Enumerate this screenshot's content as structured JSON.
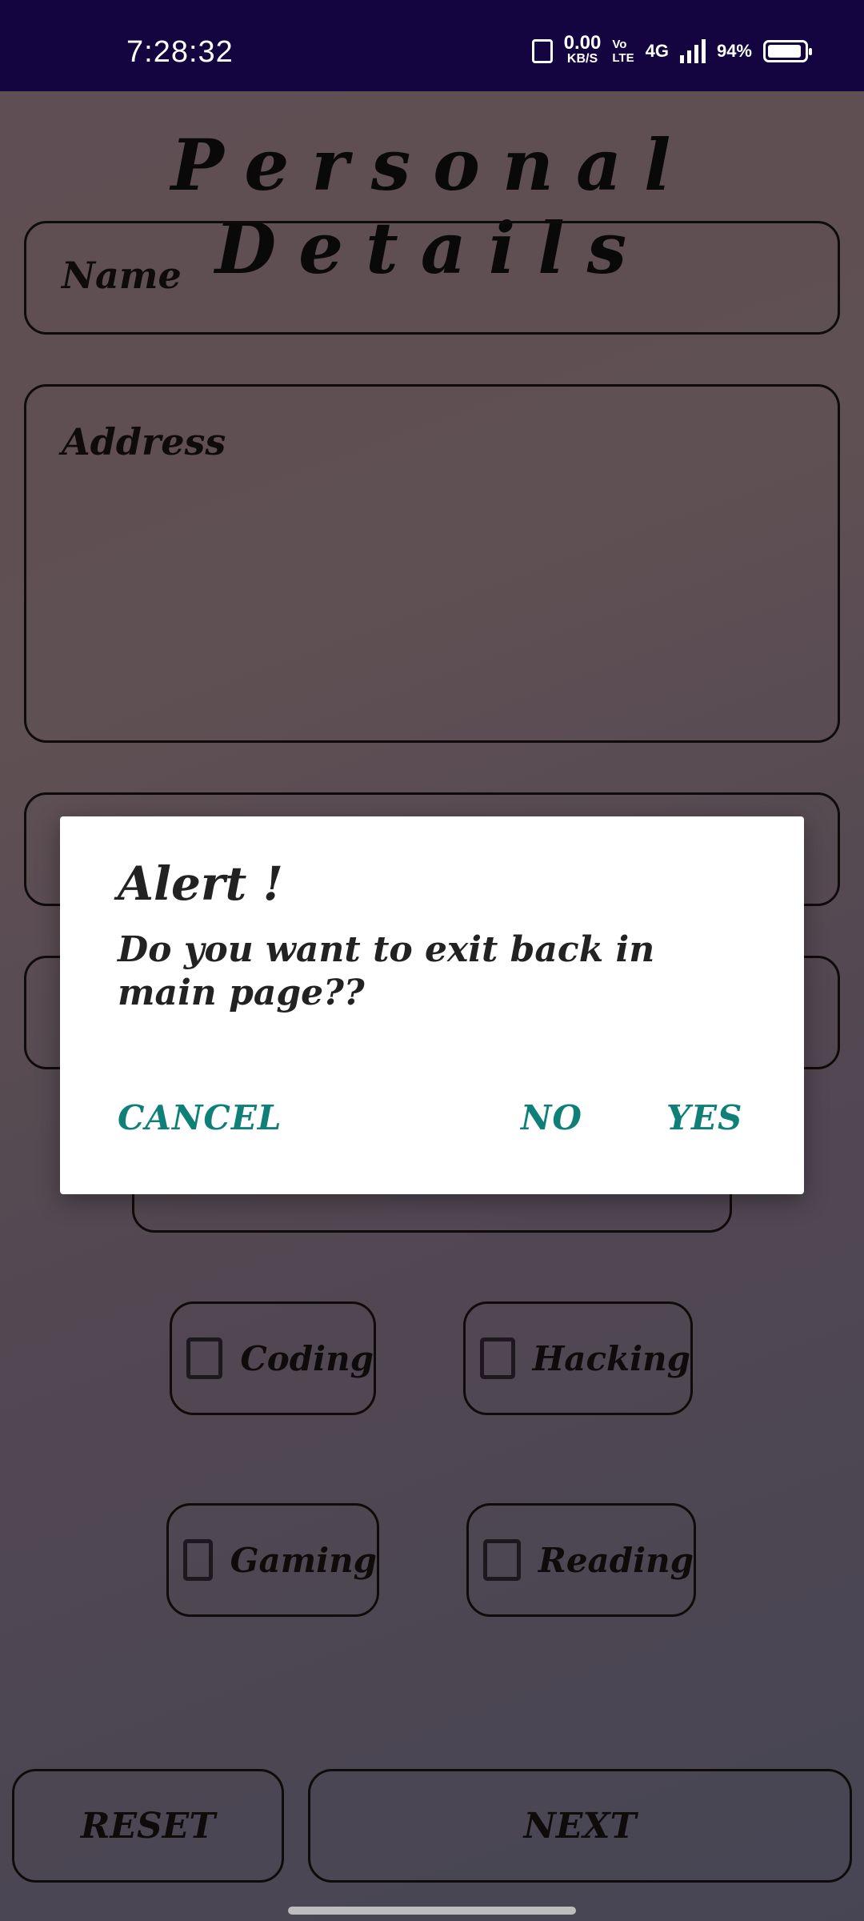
{
  "status_bar": {
    "time": "7:28:32",
    "net_speed_value": "0.00",
    "net_speed_unit": "KB/S",
    "volte_top": "Vo",
    "volte_bottom": "LTE",
    "network": "4G",
    "battery": "94%"
  },
  "form": {
    "title": "Personal Details",
    "name_placeholder": "Name",
    "address_placeholder": "Address"
  },
  "hobbies": [
    {
      "label": "Coding",
      "checked": false
    },
    {
      "label": "Hacking",
      "checked": false
    },
    {
      "label": "Gaming",
      "checked": false
    },
    {
      "label": "Reading",
      "checked": false
    }
  ],
  "buttons": {
    "reset": "RESET",
    "next": "NEXT"
  },
  "dialog": {
    "title": "Alert !",
    "message": "Do you want to exit back in main page??",
    "cancel": "CANCEL",
    "no": "NO",
    "yes": "YES",
    "accent_color": "#0f8078"
  }
}
